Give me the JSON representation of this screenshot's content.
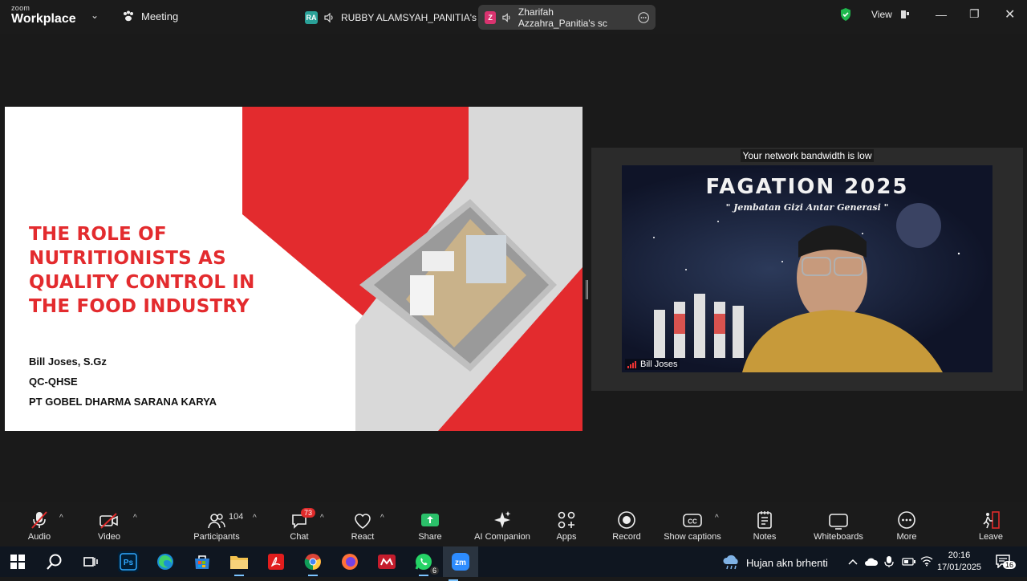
{
  "app": {
    "brand_small": "zoom",
    "brand_big": "Workplace",
    "meeting_label": "Meeting"
  },
  "share_tabs": [
    {
      "initials": "RA",
      "color": "#2aa198",
      "label": "RUBBY ALAMSYAH_PANITIA's sc"
    },
    {
      "initials": "Z",
      "color": "#d9336f",
      "label": "Zharifah Azzahra_Panitia's sc"
    }
  ],
  "header": {
    "view_label": "View",
    "secure_color": "#1fb84d"
  },
  "slide": {
    "title_lines": [
      "THE ROLE OF",
      "NUTRITIONISTS AS",
      "QUALITY CONTROL IN",
      "THE FOOD INDUSTRY"
    ],
    "presenter": "Bill Joses, S.Gz",
    "role": "QC-QHSE",
    "company": "PT GOBEL DHARMA SARANA KARYA",
    "accent_color": "#e32b2e"
  },
  "video": {
    "bandwidth_note": "Your network bandwidth is low",
    "event_title": "FAGATION 2025",
    "event_subtitle": "\" Jembatan Gizi Antar Generasi \"",
    "participant_name": "Bill Joses"
  },
  "toolbar": {
    "audio": "Audio",
    "video": "Video",
    "participants": "Participants",
    "participants_count": "104",
    "chat": "Chat",
    "chat_badge": "73",
    "react": "React",
    "share": "Share",
    "ai_companion": "AI Companion",
    "apps": "Apps",
    "record": "Record",
    "show_captions": "Show captions",
    "notes": "Notes",
    "whiteboards": "Whiteboards",
    "more": "More",
    "leave": "Leave"
  },
  "taskbar": {
    "whatsapp_badge": "6",
    "weather": "Hujan akn brhenti",
    "time": "20:16",
    "date": "17/01/2025",
    "notifications": "16"
  }
}
